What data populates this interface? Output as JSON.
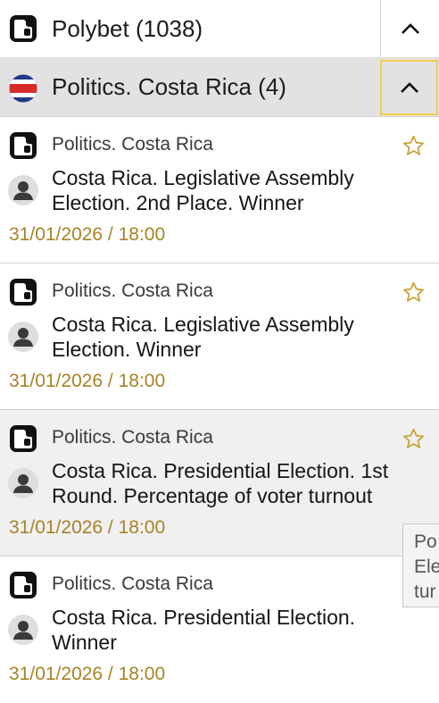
{
  "header": {
    "title": "Polybet (1038)"
  },
  "subheader": {
    "title": "Politics. Costa Rica (4)"
  },
  "events": [
    {
      "category": "Politics. Costa Rica",
      "name": "Costa Rica. Legislative Assembly Election. 2nd Place. Winner",
      "date": "31/01/2026 / 18:00"
    },
    {
      "category": "Politics. Costa Rica",
      "name": "Costa Rica. Legislative Assembly Election. Winner",
      "date": "31/01/2026 / 18:00"
    },
    {
      "category": "Politics. Costa Rica",
      "name": "Costa Rica. Presidential Election. 1st Round. Percentage of voter turnout",
      "date": "31/01/2026 / 18:00"
    },
    {
      "category": "Politics. Costa Rica",
      "name": "Costa Rica. Presidential Election. Winner",
      "date": "31/01/2026 / 18:00"
    }
  ],
  "tooltip": {
    "line1": "Po",
    "line2": "Ele",
    "line3": "tur"
  },
  "colors": {
    "date": "#a88326",
    "star": "#c9a23a",
    "focus_border": "#f2cf4a",
    "subheader_bg": "#e2e2e2"
  }
}
